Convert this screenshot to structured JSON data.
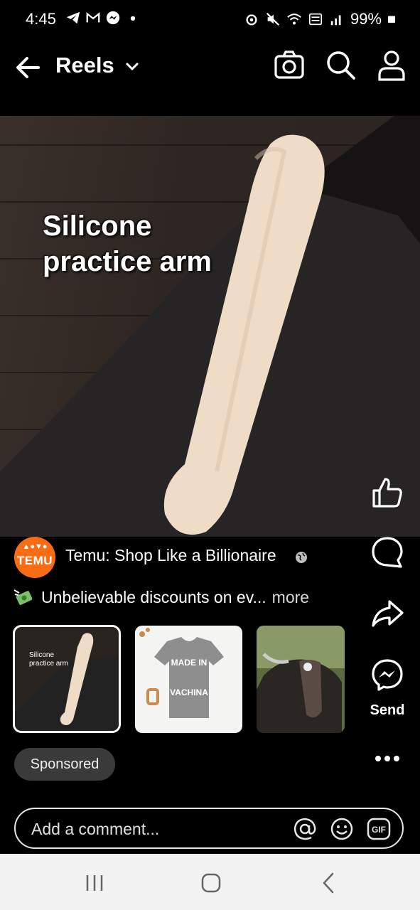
{
  "status_bar": {
    "time": "4:45",
    "battery": "99%",
    "left_icons": [
      "telegram-icon",
      "gmail-icon",
      "messenger-icon",
      "dot-icon"
    ],
    "right_icons": [
      "alarm-icon",
      "mute-icon",
      "wifi-icon",
      "volte-icon",
      "signal-icon",
      "battery-icon"
    ]
  },
  "header": {
    "title": "Reels",
    "icons": [
      "back-arrow-icon",
      "chevron-down-icon",
      "camera-icon",
      "search-icon",
      "profile-icon"
    ]
  },
  "video": {
    "overlay_line1": "Silicone",
    "overlay_line2": "practice arm"
  },
  "actions": {
    "send_label": "Send",
    "icons": [
      "like-icon",
      "comment-icon",
      "share-icon",
      "messenger-send-icon",
      "more-icon"
    ]
  },
  "author": {
    "name": "Temu: Shop Like a Billionaire",
    "avatar_text": "TEMU",
    "brand_color": "#f86d14"
  },
  "caption": {
    "text": "Unbelievable discounts on ev...",
    "more": "more"
  },
  "thumbnails": [
    {
      "label_line1": "Silicone",
      "label_line2": "practice arm",
      "selected": true
    },
    {
      "label_line1": "MADE IN",
      "label_line2": "VACHINA",
      "selected": false
    },
    {
      "label_line1": "",
      "label_line2": "",
      "selected": false
    }
  ],
  "sponsored": "Sponsored",
  "comment": {
    "placeholder": "Add a comment...",
    "gif": "GIF"
  },
  "nav": {
    "icons": [
      "recents-icon",
      "home-icon",
      "back-icon"
    ]
  }
}
